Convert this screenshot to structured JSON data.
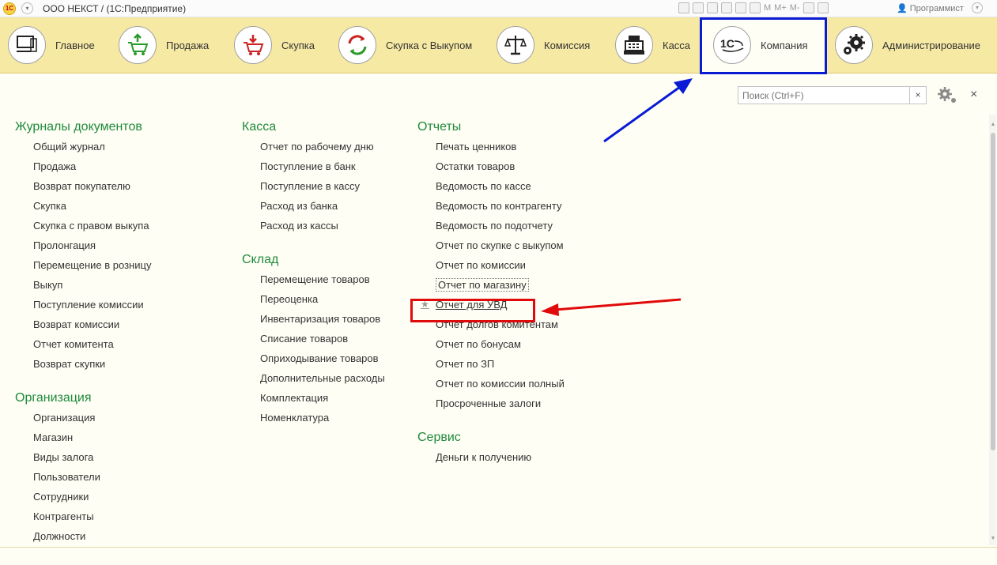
{
  "window": {
    "title": "ООО НЕКСТ /   (1С:Предприятие)",
    "user": "Программист",
    "toolbar_text": [
      "M",
      "M+",
      "M-"
    ]
  },
  "sections": [
    {
      "label": "Главное",
      "icon": "computer-icon"
    },
    {
      "label": "Продажа",
      "icon": "cart-up-icon"
    },
    {
      "label": "Скупка",
      "icon": "cart-down-icon"
    },
    {
      "label": "Скупка с Выкупом",
      "icon": "cycle-arrows-icon"
    },
    {
      "label": "Комиссия",
      "icon": "scales-icon"
    },
    {
      "label": "Касса",
      "icon": "cash-register-icon"
    },
    {
      "label": "Компания",
      "icon": "company-logo-icon"
    },
    {
      "label": "Администрирование",
      "icon": "gears-icon"
    }
  ],
  "search": {
    "placeholder": "Поиск (Ctrl+F)",
    "clear": "×"
  },
  "close": "×",
  "columns": {
    "col1": {
      "groups": [
        {
          "title": "Журналы документов",
          "items": [
            "Общий журнал",
            "Продажа",
            "Возврат покупателю",
            "Скупка",
            "Скупка с правом выкупа",
            "Пролонгация",
            "Перемещение в розницу",
            "Выкуп",
            "Поступление комиссии",
            "Возврат комиссии",
            "Отчет комитента",
            "Возврат скупки"
          ]
        },
        {
          "title": "Организация",
          "items": [
            "Организация",
            "Магазин",
            "Виды залога",
            "Пользователи",
            "Сотрудники",
            "Контрагенты",
            "Должности"
          ]
        }
      ]
    },
    "col2": {
      "groups": [
        {
          "title": "Касса",
          "items": [
            "Отчет по рабочему дню",
            "Поступление в банк",
            "Поступление в кассу",
            "Расход из банка",
            "Расход из кассы"
          ]
        },
        {
          "title": "Склад",
          "items": [
            "Перемещение товаров",
            "Переоценка",
            "Инвентаризация товаров",
            "Списание товаров",
            "Оприходывание товаров",
            "Дополнительные расходы",
            "Комплектация",
            "Номенклатура"
          ]
        }
      ]
    },
    "col3": {
      "groups": [
        {
          "title": "Отчеты",
          "items": [
            "Печать ценников",
            "Остатки товаров",
            "Ведомость по кассе",
            "Ведомость по контрагенту",
            "Ведомость по подотчету",
            "Отчет по скупке с выкупом",
            "Отчет по комиссии",
            "Отчет по магазину",
            "Отчет для УВД",
            "Отчет долгов комитентам",
            "Отчет по бонусам",
            "Отчет по ЗП",
            "Отчет по комиссии полный",
            "Просроченные залоги"
          ]
        },
        {
          "title": "Сервис",
          "items": [
            "Деньги к получению"
          ]
        }
      ]
    }
  },
  "colors": {
    "accent_green": "#1e8a3c",
    "section_bar": "#f6e9a4",
    "highlight_blue": "#0a1bd6",
    "highlight_red": "#e00a0a"
  }
}
